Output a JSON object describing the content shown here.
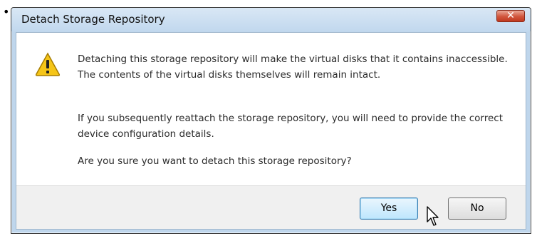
{
  "page": {
    "bullet": "•"
  },
  "dialog": {
    "title": "Detach Storage Repository",
    "close_glyph": "✕",
    "icon": "warning-icon",
    "message_1": "Detaching this storage repository will make the virtual disks that it contains inaccessible. The contents of the virtual disks themselves will remain intact.",
    "message_2": "If you subsequently reattach the storage repository, you will need to provide the correct device configuration details.",
    "question": "Are you sure you want to detach this storage repository?",
    "buttons": {
      "yes": "Yes",
      "no": "No"
    }
  },
  "colors": {
    "titlebar": "#c9dcef",
    "close_button": "#d1553c",
    "warning": "#f5c518",
    "yes_button_highlight": "#bee6fd"
  }
}
